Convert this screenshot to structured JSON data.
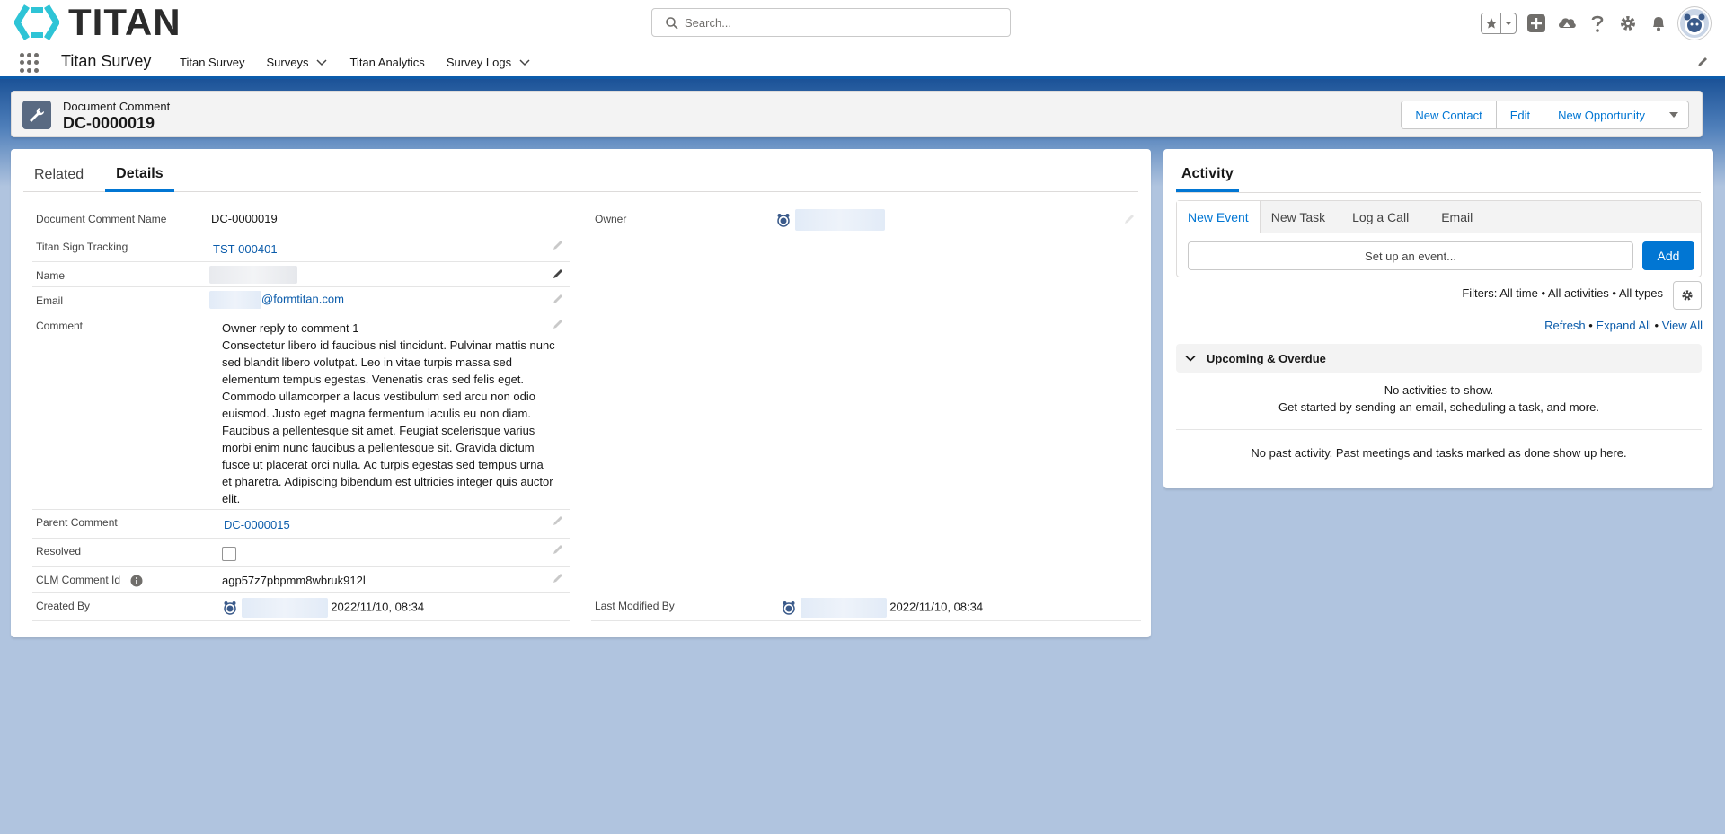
{
  "header": {
    "logo_text": "TITAN",
    "search_placeholder": "Search..."
  },
  "nav": {
    "app_name": "Titan Survey",
    "items": [
      {
        "label": "Titan Survey",
        "has_menu": false
      },
      {
        "label": "Surveys",
        "has_menu": true
      },
      {
        "label": "Titan Analytics",
        "has_menu": false
      },
      {
        "label": "Survey Logs",
        "has_menu": true
      }
    ]
  },
  "record": {
    "type": "Document Comment",
    "title": "DC-0000019",
    "actions": [
      "New Contact",
      "Edit",
      "New Opportunity"
    ]
  },
  "tabs": {
    "related": "Related",
    "details": "Details"
  },
  "fields": {
    "doc_comment_name_label": "Document Comment Name",
    "doc_comment_name_value": "DC-0000019",
    "owner_label": "Owner",
    "titan_sign_tracking_label": "Titan Sign Tracking",
    "titan_sign_tracking_value": "TST-000401",
    "name_label": "Name",
    "email_label": "Email",
    "email_value": "@formtitan.com",
    "comment_label": "Comment",
    "comment_value": "Owner reply to comment 1\nConsectetur libero id faucibus nisl tincidunt. Pulvinar mattis nunc sed blandit libero volutpat. Leo in vitae turpis massa sed elementum tempus egestas. Venenatis cras sed felis eget. Commodo ullamcorper a lacus vestibulum sed arcu non odio euismod. Justo eget magna fermentum iaculis eu non diam. Faucibus a pellentesque sit amet. Feugiat scelerisque varius morbi enim nunc faucibus a pellentesque sit. Gravida dictum fusce ut placerat orci nulla. Ac turpis egestas sed tempus urna et pharetra. Adipiscing bibendum est ultricies integer quis auctor elit.",
    "parent_comment_label": "Parent Comment",
    "parent_comment_value": "DC-0000015",
    "resolved_label": "Resolved",
    "resolved_checked": false,
    "clm_comment_id_label": "CLM Comment Id",
    "clm_comment_id_value": "agp57z7pbpmm8wbruk912l",
    "created_by_label": "Created By",
    "created_by_date": "2022/11/10, 08:34",
    "last_modified_by_label": "Last Modified By",
    "last_modified_by_date": "2022/11/10, 08:34"
  },
  "activity": {
    "title": "Activity",
    "subtabs": [
      "New Event",
      "New Task",
      "Log a Call",
      "Email"
    ],
    "input_placeholder": "Set up an event...",
    "add_label": "Add",
    "filters": "Filters: All time • All activities • All types",
    "refresh": "Refresh",
    "expand_all": "Expand All",
    "view_all": "View All",
    "upcoming_label": "Upcoming & Overdue",
    "no_activities": "No activities to show.",
    "get_started": "Get started by sending an email, scheduling a task, and more.",
    "no_past": "No past activity. Past meetings and tasks marked as done show up here."
  },
  "colors": {
    "brand_blue": "#0176d3",
    "link_blue": "#0b5cab",
    "logo_teal": "#2ec4d6"
  }
}
